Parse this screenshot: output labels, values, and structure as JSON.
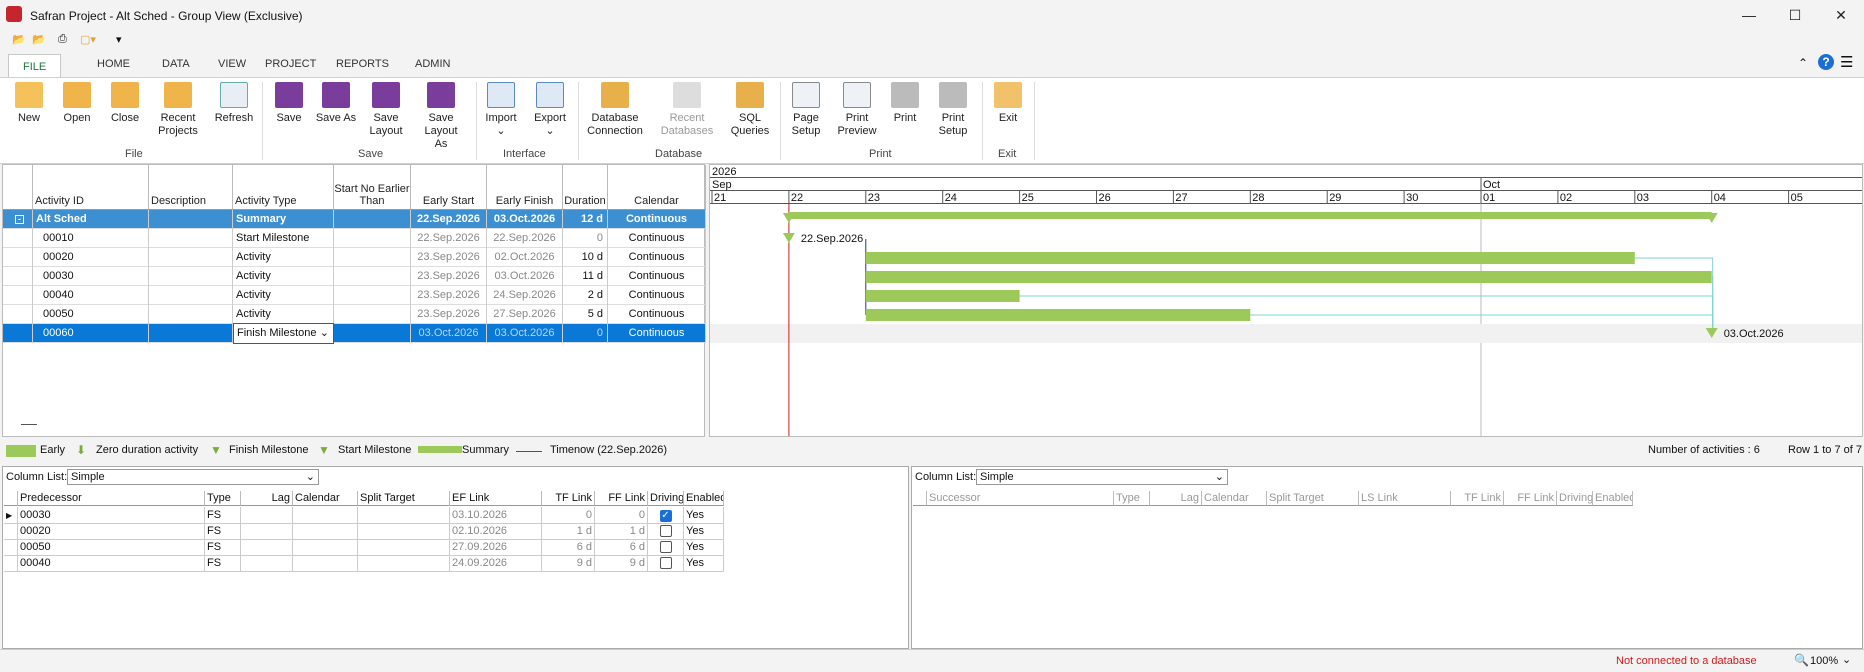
{
  "window": {
    "title": "Safran Project - Alt Sched - Group View (Exclusive)"
  },
  "ribbon_tabs": [
    "FILE",
    "HOME",
    "DATA",
    "VIEW",
    "PROJECT",
    "REPORTS",
    "ADMIN"
  ],
  "ribbon": {
    "new": "New",
    "open": "Open",
    "close": "Close",
    "recent_projects": "Recent Projects",
    "refresh": "Refresh",
    "save": "Save",
    "save_as": "Save As",
    "save_layout": "Save Layout",
    "save_layout_as": "Save Layout As",
    "import": "Import",
    "export": "Export",
    "db_connection": "Database Connection",
    "recent_databases": "Recent Databases",
    "sql_queries": "SQL Queries",
    "page_setup": "Page Setup",
    "print_preview": "Print Preview",
    "print": "Print",
    "print_setup": "Print Setup",
    "exit": "Exit",
    "groups": {
      "file": "File",
      "save": "Save",
      "interface": "Interface",
      "database": "Database",
      "print": "Print",
      "exit": "Exit"
    }
  },
  "grid": {
    "headers": {
      "activity_id": "Activity ID",
      "description": "Description",
      "activity_type": "Activity Type",
      "snet": "Start No Earlier Than",
      "early_start": "Early Start",
      "early_finish": "Early Finish",
      "duration": "Duration",
      "calendar": "Calendar"
    },
    "rows": [
      {
        "id": "Alt Sched",
        "type": "Summary",
        "es": "22.Sep.2026",
        "ef": "03.Oct.2026",
        "dur": "12 d",
        "cal": "Continuous"
      },
      {
        "id": "00010",
        "type": "Start Milestone",
        "es": "22.Sep.2026",
        "ef": "22.Sep.2026",
        "dur": "0",
        "cal": "Continuous"
      },
      {
        "id": "00020",
        "type": "Activity",
        "es": "23.Sep.2026",
        "ef": "02.Oct.2026",
        "dur": "10 d",
        "cal": "Continuous"
      },
      {
        "id": "00030",
        "type": "Activity",
        "es": "23.Sep.2026",
        "ef": "03.Oct.2026",
        "dur": "11 d",
        "cal": "Continuous"
      },
      {
        "id": "00040",
        "type": "Activity",
        "es": "23.Sep.2026",
        "ef": "24.Sep.2026",
        "dur": "2 d",
        "cal": "Continuous"
      },
      {
        "id": "00050",
        "type": "Activity",
        "es": "23.Sep.2026",
        "ef": "27.Sep.2026",
        "dur": "5 d",
        "cal": "Continuous"
      },
      {
        "id": "00060",
        "type": "Finish Milestone",
        "es": "03.Oct.2026",
        "ef": "03.Oct.2026",
        "dur": "0",
        "cal": "Continuous"
      }
    ]
  },
  "gantt": {
    "year": "2026",
    "month1": "Sep",
    "month2": "Oct",
    "days": [
      "21",
      "22",
      "23",
      "24",
      "25",
      "26",
      "27",
      "28",
      "29",
      "30",
      "01",
      "02",
      "03",
      "04",
      "05"
    ],
    "start_label": "22.Sep.2026",
    "finish_label": "03.Oct.2026",
    "bars": [
      {
        "row": 2,
        "start": "2026-09-23",
        "finish": "2026-10-02"
      },
      {
        "row": 3,
        "start": "2026-09-23",
        "finish": "2026-10-03"
      },
      {
        "row": 4,
        "start": "2026-09-23",
        "finish": "2026-09-24"
      },
      {
        "row": 5,
        "start": "2026-09-23",
        "finish": "2026-09-27"
      }
    ]
  },
  "legend": {
    "early": "Early",
    "zero": "Zero duration activity",
    "finish": "Finish Milestone",
    "start": "Start Milestone",
    "summary": "Summary",
    "timenow": "Timenow (22.Sep.2026)",
    "count": "Number of activities : 6",
    "rows": "Row 1 to 7 of 7"
  },
  "pred": {
    "column_list_label": "Column List:",
    "column_list_value": "Simple",
    "headers": [
      "Predecessor",
      "Type",
      "Lag",
      "Calendar",
      "Split Target",
      "EF Link",
      "TF Link",
      "FF Link",
      "Driving",
      "Enabled"
    ],
    "rows": [
      {
        "p": "00030",
        "t": "FS",
        "ef": "03.10.2026",
        "tf": "0",
        "ff": "0",
        "drv": true,
        "en": "Yes"
      },
      {
        "p": "00020",
        "t": "FS",
        "ef": "02.10.2026",
        "tf": "1 d",
        "ff": "1 d",
        "drv": false,
        "en": "Yes"
      },
      {
        "p": "00050",
        "t": "FS",
        "ef": "27.09.2026",
        "tf": "6 d",
        "ff": "6 d",
        "drv": false,
        "en": "Yes"
      },
      {
        "p": "00040",
        "t": "FS",
        "ef": "24.09.2026",
        "tf": "9 d",
        "ff": "9 d",
        "drv": false,
        "en": "Yes"
      }
    ]
  },
  "succ": {
    "column_list_label": "Column List:",
    "column_list_value": "Simple",
    "headers": [
      "Successor",
      "Type",
      "Lag",
      "Calendar",
      "Split Target",
      "LS Link",
      "TF Link",
      "FF Link",
      "Driving",
      "Enabled"
    ]
  },
  "status": {
    "db": "Not connected to a database",
    "zoom": "100%"
  },
  "colors": {
    "bar": "#9cc95a",
    "select": "#0a78d6",
    "summary_row": "#3c8fd0",
    "timenow": "#d01b1b"
  }
}
